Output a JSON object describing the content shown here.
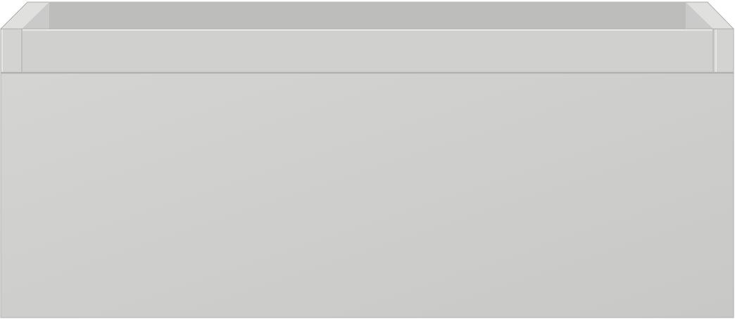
{
  "object": {
    "kind": "drawer-unit",
    "colors": {
      "background": "#ffffff",
      "front_panel_light": "#d4d4d2",
      "front_panel_dark": "#c8c8c6",
      "outer_frame": "#d3d3d1",
      "outer_frame_edge": "#e6e6e4",
      "inner_back_wall": "#bdbdbc",
      "inner_side_wall": "#cacaca",
      "drawer_rim": "#d0d0ce",
      "drawer_rim_highlight": "#ececea",
      "top_edge": "#e0e0de",
      "outline": "#adadac",
      "shadow_line": "#b5b5b3"
    }
  }
}
